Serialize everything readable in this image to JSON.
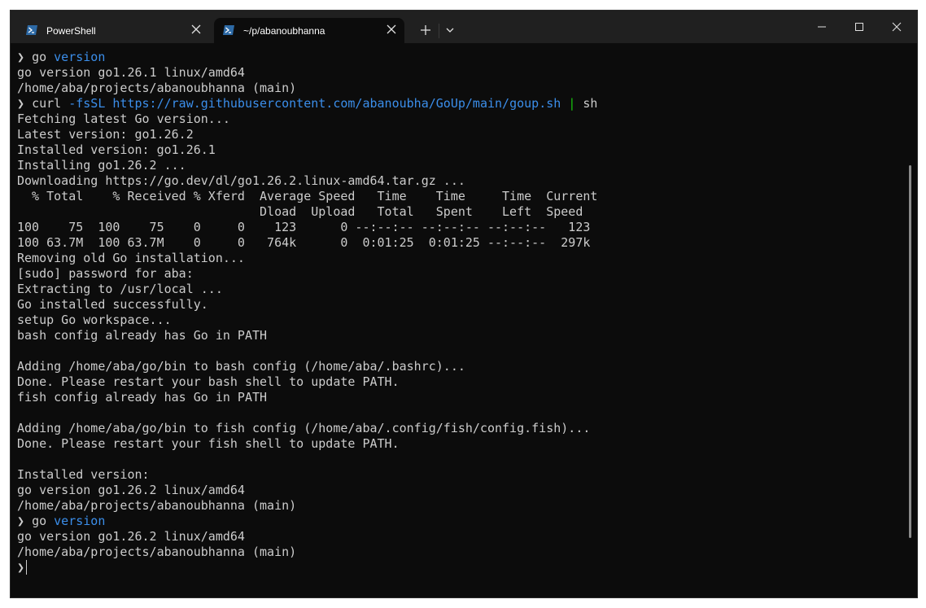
{
  "tabs": [
    {
      "label": "PowerShell",
      "icon": "powershell-icon",
      "active": false
    },
    {
      "label": "~/p/abanoubhanna",
      "icon": "powershell-icon",
      "active": true
    }
  ],
  "colors": {
    "background": "#0c0c0c",
    "titlebar": "#202020",
    "foreground": "#cccccc",
    "keyword_blue": "#3b8eea",
    "pipe_green": "#16c60c"
  },
  "terminal": {
    "line1": {
      "prompt": "❯",
      "cmd": "go",
      "arg": "version"
    },
    "line2": "go version go1.26.1 linux/amd64",
    "line3": "/home/aba/projects/abanoubhanna (main)",
    "line4": {
      "prompt": "❯",
      "cmd": "curl",
      "flag": "-fsSL",
      "url": "https://raw.githubusercontent.com/abanoubha/GoUp/main/goup.sh",
      "pipe": "|",
      "cmd2": "sh"
    },
    "line5": "Fetching latest Go version...",
    "line6": "Latest version: go1.26.2",
    "line7": "Installed version: go1.26.1",
    "line8": "Installing go1.26.2 ...",
    "line9": "Downloading https://go.dev/dl/go1.26.2.linux-amd64.tar.gz ...",
    "line10": "  % Total    % Received % Xferd  Average Speed   Time    Time     Time  Current",
    "line11": "                                 Dload  Upload   Total   Spent    Left  Speed",
    "line12": "100    75  100    75    0     0    123      0 --:--:-- --:--:-- --:--:--   123",
    "line13": "100 63.7M  100 63.7M    0     0   764k      0  0:01:25  0:01:25 --:--:--  297k",
    "line14": "Removing old Go installation...",
    "line15": "[sudo] password for aba:",
    "line16": "Extracting to /usr/local ...",
    "line17": "Go installed successfully.",
    "line18": "setup Go workspace...",
    "line19": "bash config already has Go in PATH",
    "line20": "",
    "line21": "Adding /home/aba/go/bin to bash config (/home/aba/.bashrc)...",
    "line22": "Done. Please restart your bash shell to update PATH.",
    "line23": "fish config already has Go in PATH",
    "line24": "",
    "line25": "Adding /home/aba/go/bin to fish config (/home/aba/.config/fish/config.fish)...",
    "line26": "Done. Please restart your fish shell to update PATH.",
    "line27": "",
    "line28": "Installed version:",
    "line29": "go version go1.26.2 linux/amd64",
    "line30": "/home/aba/projects/abanoubhanna (main)",
    "line31": {
      "prompt": "❯",
      "cmd": "go",
      "arg": "version"
    },
    "line32": "go version go1.26.2 linux/amd64",
    "line33": "/home/aba/projects/abanoubhanna (main)",
    "line34": {
      "prompt": "❯"
    }
  }
}
